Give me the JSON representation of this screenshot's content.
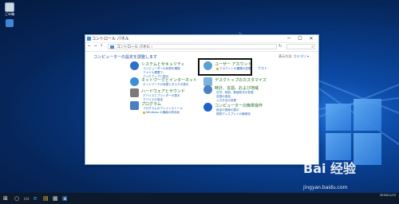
{
  "desktop": {
    "icons": [
      {
        "label": "ごみ箱"
      },
      {
        "label": ""
      }
    ]
  },
  "window": {
    "title": "コントロール パネル",
    "controls": {
      "minimize": "─",
      "maximize": "☐",
      "close": "✕"
    },
    "nav": {
      "back": "←",
      "forward": "→",
      "up": "↑"
    },
    "address": "コントロール パネル ›",
    "refresh": "↻",
    "search_icon": "⌕"
  },
  "main": {
    "heading": "コンピューターの設定を調整します",
    "view_by_label": "表示方法:",
    "view_by_value": "カテゴリ ▾"
  },
  "categories_left": [
    {
      "title": "システムとセキュリティ",
      "icon_color": "#2f6fc7",
      "links": [
        "コンピューターの状態を確認",
        "ファイル履歴で...",
        "バックアップと復元"
      ]
    },
    {
      "title": "ネットワークとインターネット",
      "icon_color": "#3b8ed8",
      "links": [
        "ネットワークの状態とタスクの表示"
      ]
    },
    {
      "title": "ハードウェアとサウンド",
      "icon_color": "#7a7a7a",
      "links": [
        "デバイスとプリンターの表示",
        "デバイスの追加"
      ]
    },
    {
      "title": "プログラム",
      "icon_color": "#4a7fc2",
      "links": [
        "プログラムのアンインストール",
        "Windows の機能の有効化"
      ]
    }
  ],
  "categories_right": [
    {
      "title": "ユーザー アカウント",
      "icon_color": "#5aa0d8",
      "links": [
        "アカウントの種類の変更"
      ]
    },
    {
      "title": "デスクトップのカスタマイズ",
      "icon_color": "#7bb3e0",
      "links": []
    },
    {
      "title": "時計、言語、および地域",
      "icon_color": "#4c7fbf",
      "links": [
        "日付、時刻、数値形式の変更",
        "言語の追加",
        "入力方法の変更"
      ]
    },
    {
      "title": "コンピューターの簡単操作",
      "icon_color": "#1e62c9",
      "links": [
        "設定の提案の表示",
        "視覚ディスプレイの最適化"
      ]
    }
  ],
  "side_link": "ゲスト",
  "taskbar": {
    "start": "⊞",
    "search": "○",
    "items": [
      "▭",
      "e",
      "▤",
      "▦",
      "▣"
    ],
    "clock_time": "",
    "clock_date": "2016/11/15"
  },
  "watermark": {
    "text": "Bai 经验",
    "url": "jingyan.baidu.com"
  }
}
